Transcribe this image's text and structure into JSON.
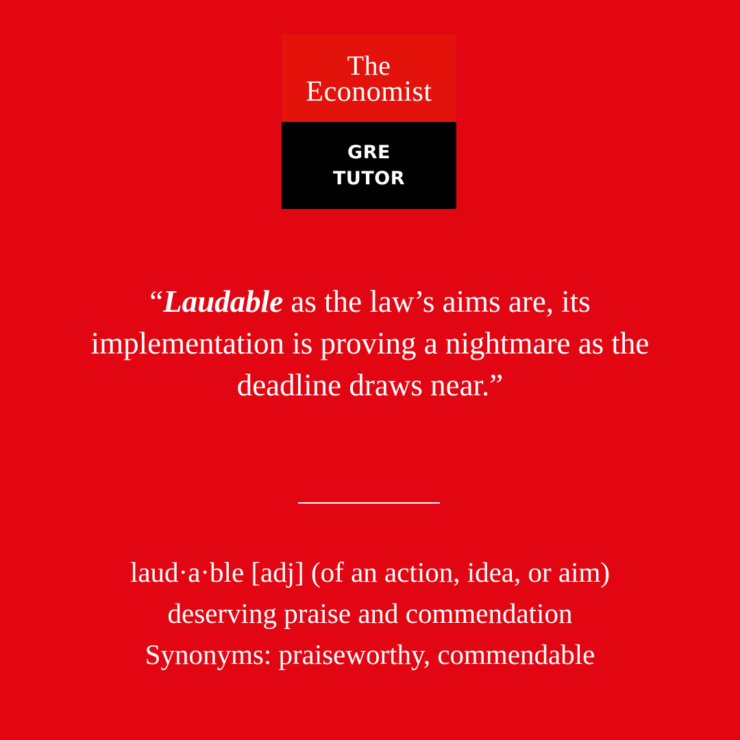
{
  "brand": {
    "logo_line1": "The",
    "logo_line2": "Economist",
    "badge_line1": "GRE",
    "badge_line2": "TUTOR",
    "colors": {
      "background": "#e20613",
      "logo_red": "#e3120b",
      "badge_black": "#000000",
      "text": "#ffffff"
    }
  },
  "quote": {
    "open_mark": "“",
    "keyword": "Laudable",
    "rest": " as the law’s aims are, its implementation is proving a nightmare as the deadline draws near.”"
  },
  "definition": {
    "line1": "laud·a·ble [adj] (of an action, idea, or aim)",
    "line2": "deserving praise and commendation",
    "line3": "Synonyms: praiseworthy, commendable"
  }
}
